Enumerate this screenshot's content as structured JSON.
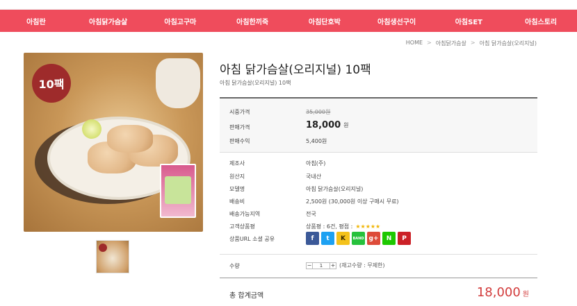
{
  "nav": {
    "items": [
      "아침란",
      "아침닭가슴살",
      "아침고구마",
      "아침한끼죽",
      "아침단호박",
      "아침생선구이",
      "아침SET",
      "아침스토리"
    ]
  },
  "breadcrumb": {
    "home": "HOME",
    "sep": ">",
    "category": "아침닭가슴살",
    "current": "아침 닭가슴살(오리지널)"
  },
  "product": {
    "badge": "10팩",
    "title": "아침 닭가슴살(오리지널) 10팩",
    "subtitle": "아침 닭가슴살(오리지널) 10팩"
  },
  "price": {
    "market_label": "시중가격",
    "market_value": "35,000원",
    "sale_label": "판매가격",
    "sale_value": "18,000",
    "sale_unit": "원",
    "profit_label": "판매수익",
    "profit_value": "5,400원"
  },
  "info": {
    "maker_label": "제조사",
    "maker_value": "아침(주)",
    "origin_label": "원산지",
    "origin_value": "국내산",
    "model_label": "모델명",
    "model_value": "아침 닭가슴살(오리지널)",
    "ship_label": "배송비",
    "ship_value": "2,500원 (30,000원 이상 구매시 무료)",
    "area_label": "배송가능지역",
    "area_value": "전국",
    "review_label": "고객상품평",
    "review_value": "상품평 : 6건, 평점 :",
    "stars": "★★★★★",
    "share_label": "상품URL 소셜 공유"
  },
  "social": {
    "facebook": "f",
    "twitter": "t",
    "kakao": "K",
    "band": "BAND",
    "google": "g+",
    "naver": "N",
    "pinterest": "P",
    "colors": {
      "facebook": "#3b5998",
      "twitter": "#1da1f2",
      "kakao": "#f4c21b",
      "band": "#26c13c",
      "google": "#dd4b39",
      "naver": "#1ec800",
      "pinterest": "#cb2027"
    }
  },
  "qty": {
    "label": "수량",
    "minus": "−",
    "value": "1",
    "plus": "+",
    "stock": "(재고수량 : 무제한)"
  },
  "total": {
    "label": "총 합계금액",
    "value": "18,000",
    "unit": "원"
  },
  "colors": {
    "nav": "#ef4c5c",
    "badge": "#9e2b2b",
    "total": "#d23b3b"
  }
}
